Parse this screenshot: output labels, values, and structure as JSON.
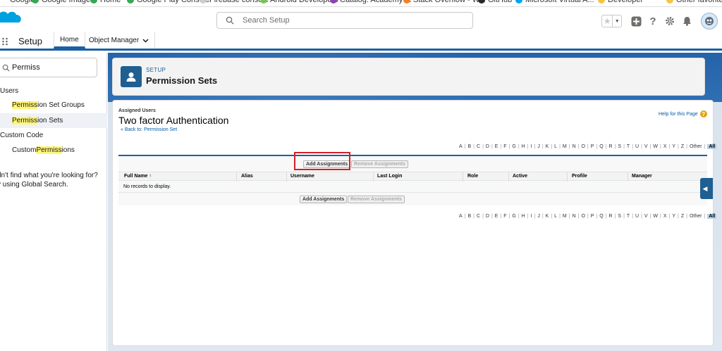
{
  "bookmarks": [
    {
      "label": "Google",
      "color": "#ffffff"
    },
    {
      "label": "Google Images",
      "color": "#34a853"
    },
    {
      "label": "Home",
      "color": "#34a853"
    },
    {
      "label": "Google Play Console",
      "color": "#34a853"
    },
    {
      "label": "Firebase console",
      "color": "#cccccc"
    },
    {
      "label": "Android Developers",
      "color": "#78c257"
    },
    {
      "label": "Catalog: Academy ...",
      "color": "#8e44ad"
    },
    {
      "label": "Stack Overflow - W...",
      "color": "#f48024"
    },
    {
      "label": "GitHub",
      "color": "#24292e"
    },
    {
      "label": "Microsoft Virtual A...",
      "color": "#00a4ef"
    },
    {
      "label": "Developer",
      "color": "#f4c542"
    },
    {
      "label": "Other favorites",
      "color": "#f4c542"
    }
  ],
  "header": {
    "search_placeholder": "Search Setup"
  },
  "app_nav": {
    "app_name": "Setup",
    "tabs": [
      {
        "label": "Home"
      },
      {
        "label": "Object Manager"
      }
    ]
  },
  "sidebar": {
    "quick_find_value": "Permiss",
    "users_node": "Users",
    "psg_pre": "Permiss",
    "psg_post": "ion Set Groups",
    "ps_pre": "Permiss",
    "ps_post": "ion Sets",
    "custom_code_node": "Custom Code",
    "cp_pre": "Custom ",
    "cp_hl": "Permiss",
    "cp_post": "ions",
    "not_found_line1": "dn't find what you're looking for?",
    "not_found_line2": "y using Global Search."
  },
  "setup_header": {
    "eyebrow": "SETUP",
    "title": "Permission Sets"
  },
  "content": {
    "assigned_label": "Assigned Users",
    "permission_set_name": "Two factor Authentication",
    "back_link": "« Back to: Permission Set",
    "help_link": "Help for this Page",
    "alphabet": [
      "A",
      "B",
      "C",
      "D",
      "E",
      "F",
      "G",
      "H",
      "I",
      "J",
      "K",
      "L",
      "M",
      "N",
      "O",
      "P",
      "Q",
      "R",
      "S",
      "T",
      "U",
      "V",
      "W",
      "X",
      "Y",
      "Z",
      "Other",
      "All"
    ],
    "add_assignments": "Add Assignments",
    "remove_assignments": "Remove Assignments",
    "columns": {
      "full_name": "Full Name",
      "sort_arrow": "↑",
      "alias": "Alias",
      "username": "Username",
      "last_login": "Last Login",
      "role": "Role",
      "active": "Active",
      "profile": "Profile",
      "manager": "Manager"
    },
    "no_records": "No records to display."
  },
  "colors": {
    "brand_blue": "#1b5fa5",
    "link": "#015ba7",
    "highlight_box": "#d51f26",
    "search_highlight": "#fff67a"
  }
}
